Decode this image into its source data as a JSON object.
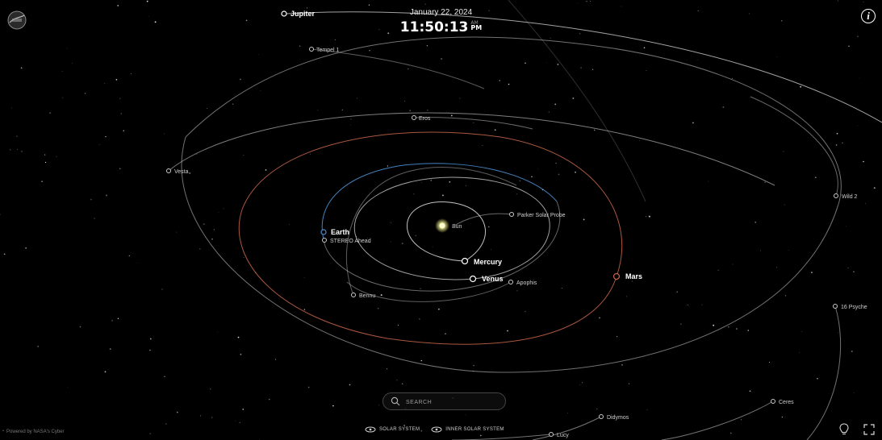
{
  "datetime": {
    "date": "January 22, 2024",
    "time": "11:50:13",
    "am": "AM",
    "pm": "PM"
  },
  "bodies": {
    "sun": "Sun",
    "mercury": "Mercury",
    "venus": "Venus",
    "earth": "Earth",
    "mars": "Mars",
    "jupiter": "Jupiter",
    "tempel1": "Tempel 1",
    "eros": "Eros",
    "vesta": "Vesta",
    "stereo": "STEREO Ahead",
    "parker": "Parker Solar Probe",
    "apophis": "Apophis",
    "bennu": "Bennu",
    "wild2": "Wild 2",
    "psyche": "16 Psyche",
    "ceres": "Ceres",
    "didymos": "Didymos",
    "lucy": "Lucy"
  },
  "search": {
    "placeholder": "SEARCH"
  },
  "views": {
    "solar_system": "SOLAR SYSTEM",
    "inner_solar_system": "INNER SOLAR SYSTEM"
  },
  "credit": "Powered by NASA's Cyber",
  "colors": {
    "background": "#000000",
    "sun": "#f3f08a",
    "earth_orbit": "#4a8fd1",
    "mars_orbit": "#c8664a",
    "orbit": "#c7c7c7"
  },
  "icons": {
    "logo": "nasa-logo",
    "info": "info-icon",
    "search": "search-icon",
    "light": "lightbulb-icon",
    "fullscreen": "fullscreen-icon"
  }
}
